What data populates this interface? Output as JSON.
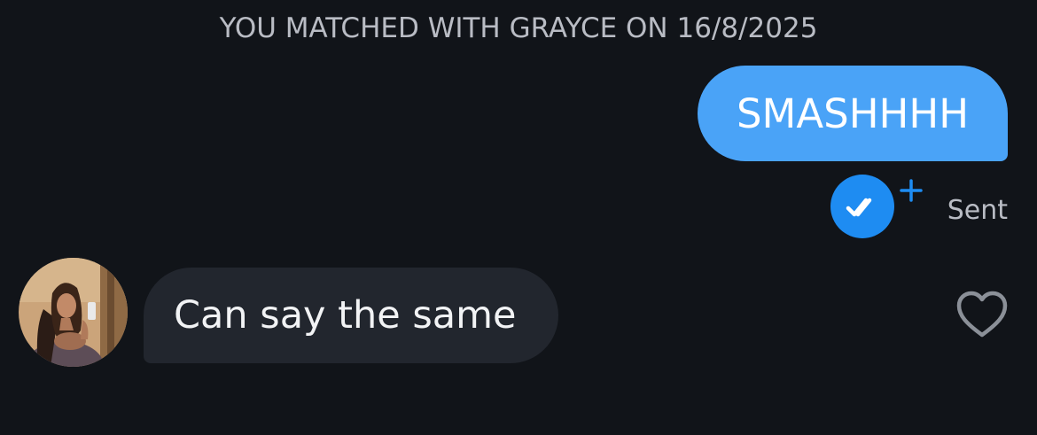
{
  "chat": {
    "match_banner": "YOU MATCHED WITH GRAYCE ON 16/8/2025",
    "messages": [
      {
        "direction": "outgoing",
        "text": "SMASHHHH",
        "status": "Sent"
      },
      {
        "direction": "incoming",
        "text": "Can say the same",
        "sender": "GRAYCE"
      }
    ]
  },
  "icons": {
    "read_receipt": "double-check-icon",
    "plus": "plus-icon",
    "heart": "heart-outline-icon"
  },
  "colors": {
    "background": "#111419",
    "outgoing_bubble": "#4aa3f7",
    "incoming_bubble": "#22262e",
    "receipt_accent": "#1e8cf2",
    "muted_text": "#b9bcc4"
  }
}
